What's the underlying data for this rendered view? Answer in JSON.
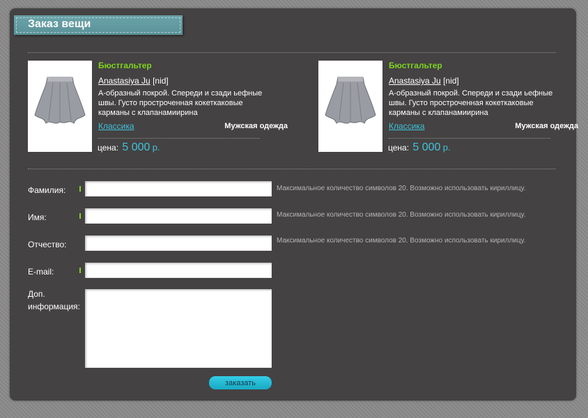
{
  "page": {
    "title": "Заказ вещи"
  },
  "products": [
    {
      "title": "Бюстгальтер",
      "author": "Anastasiya Ju",
      "author_tag": "[nid]",
      "description": "А-образный покрой. Спереди и сзади ьефные швы. Густо простроченная кокеткаковые карманы с клапанамиирина",
      "category": "Классика",
      "type": "Мужская одежда",
      "price_label": "цена:",
      "price": "5 000",
      "currency": "р."
    },
    {
      "title": "Бюстгальтер",
      "author": "Anastasiya Ju",
      "author_tag": "[nid]",
      "description": "А-образный покрой. Спереди и сзади ьефные швы. Густо простроченная кокеткаковые карманы с клапанамиирина",
      "category": "Классика",
      "type": "Мужская одежда",
      "price_label": "цена:",
      "price": "5 000",
      "currency": "р."
    }
  ],
  "form": {
    "last_name": {
      "label": "Фамилия:",
      "value": "",
      "hint": "Максимальное количество символов 20. Возможно использовать кириллицу."
    },
    "first_name": {
      "label": "Имя:",
      "value": "",
      "hint": "Максимальное количество символов 20. Возможно использовать кириллицу."
    },
    "patronymic": {
      "label": "Отчество:",
      "value": "",
      "hint": "Максимальное количество символов 20. Возможно использовать кириллицу."
    },
    "email": {
      "label": "E-mail:",
      "value": ""
    },
    "extra": {
      "label_line1": "Доп.",
      "label_line2": "информация:",
      "value": ""
    },
    "submit_label": "заказать"
  },
  "colors": {
    "panel": "#444242",
    "accent_green": "#7ed321",
    "accent_cyan": "#3fc2dc",
    "ribbon": "#5a9298"
  }
}
